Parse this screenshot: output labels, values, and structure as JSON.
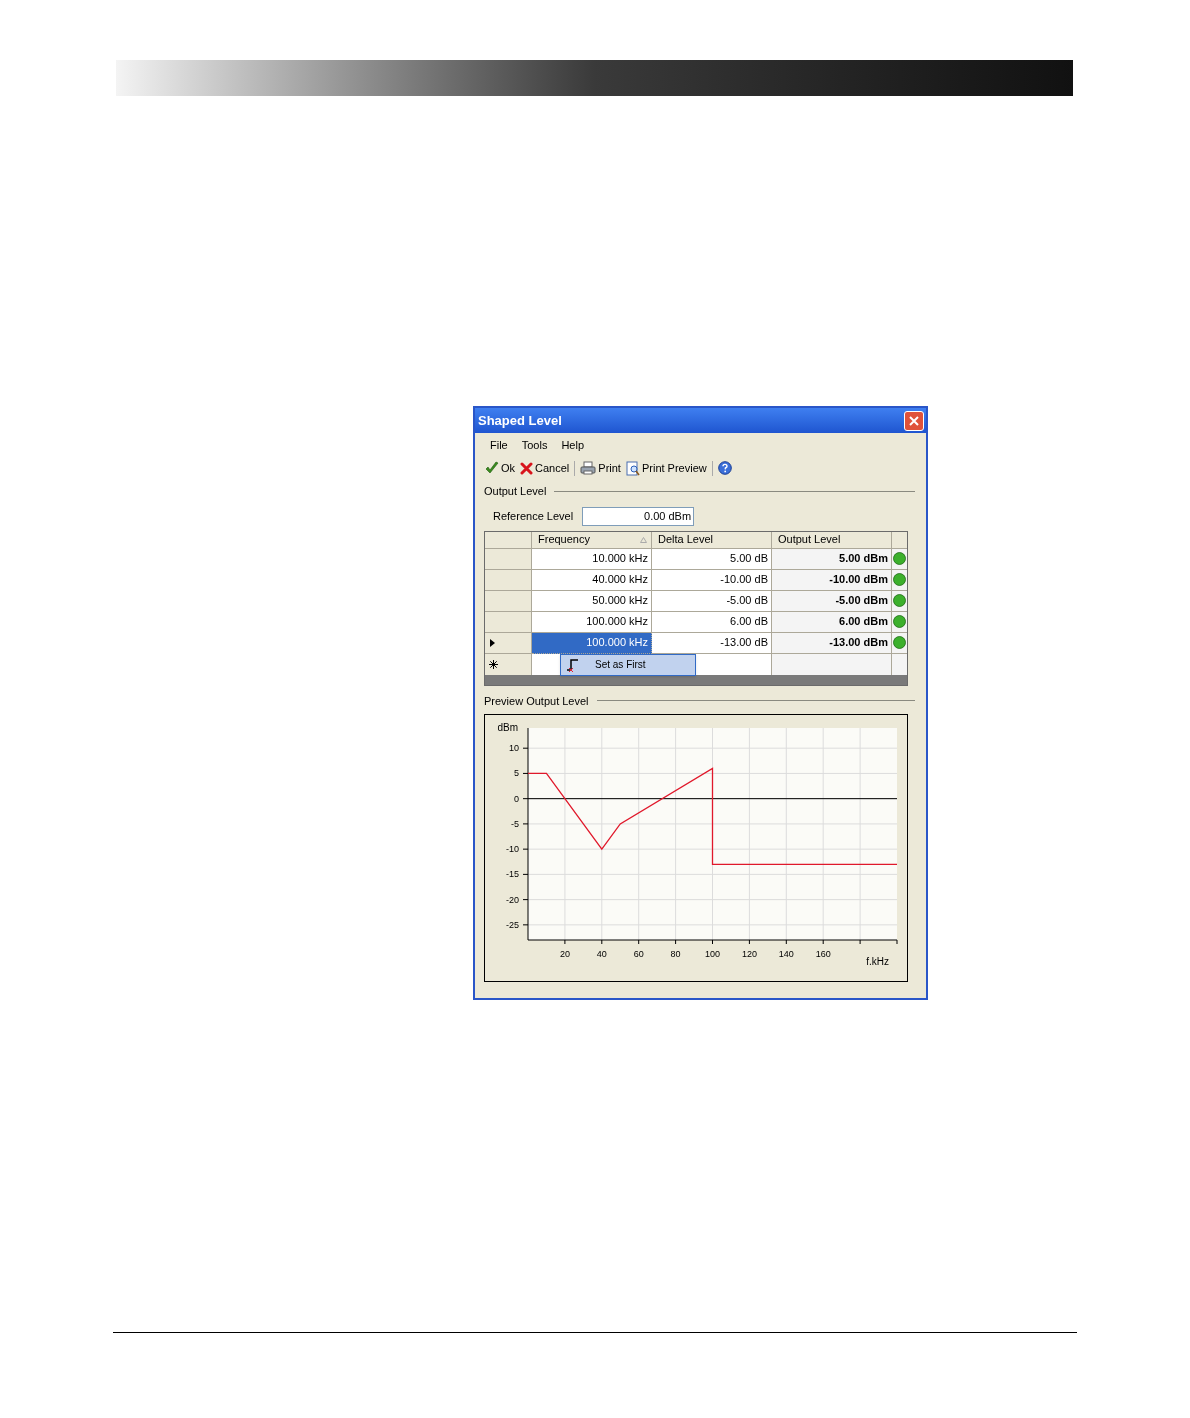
{
  "window": {
    "title": "Shaped Level"
  },
  "menu": [
    {
      "label": "File"
    },
    {
      "label": "Tools"
    },
    {
      "label": "Help"
    }
  ],
  "toolbar": [
    {
      "kind": "ok",
      "label": "Ok"
    },
    {
      "kind": "cancel",
      "label": "Cancel"
    },
    {
      "kind": "separator"
    },
    {
      "kind": "print",
      "label": "Print"
    },
    {
      "kind": "preview",
      "label": "Print Preview"
    },
    {
      "kind": "separator"
    },
    {
      "kind": "help"
    }
  ],
  "output_level": {
    "legend": "Output Level",
    "reference_label": "Reference Level",
    "reference_value": "0.00 dBm",
    "table": {
      "columns": [
        "Frequency",
        "Delta Level",
        "Output Level"
      ],
      "rows": [
        {
          "frequency": "10.000 kHz",
          "delta": "5.00 dB",
          "output": "5.00 dBm",
          "selected": false
        },
        {
          "frequency": "40.000 kHz",
          "delta": "-10.00 dB",
          "output": "-10.00 dBm",
          "selected": false
        },
        {
          "frequency": "50.000 kHz",
          "delta": "-5.00 dB",
          "output": "-5.00 dBm",
          "selected": false
        },
        {
          "frequency": "100.000 kHz",
          "delta": "6.00 dB",
          "output": "6.00 dBm",
          "selected": false
        },
        {
          "frequency": "100.000 kHz",
          "delta": "-13.00 dB",
          "output": "-13.00 dBm",
          "selected": true
        }
      ]
    }
  },
  "context_menu": {
    "items": [
      {
        "label": "Set as First"
      }
    ]
  },
  "preview": {
    "legend": "Preview Output Level",
    "chart_data": {
      "type": "line",
      "xlabel": "f.kHz",
      "ylabel": "dBm",
      "x": [
        0,
        10,
        40,
        50,
        100,
        100,
        200
      ],
      "grid": true,
      "series": [
        {
          "color": "#e0182b",
          "values": [
            5,
            5,
            -10,
            -5,
            6,
            -13,
            -13
          ]
        }
      ],
      "xlim": [
        0,
        200
      ],
      "ylim": [
        -28,
        14
      ],
      "xticks": [
        20,
        40,
        60,
        80,
        100,
        120,
        140,
        160
      ],
      "yticks": [
        10,
        5,
        0,
        -5,
        -10,
        -15,
        -20,
        -25
      ]
    }
  }
}
